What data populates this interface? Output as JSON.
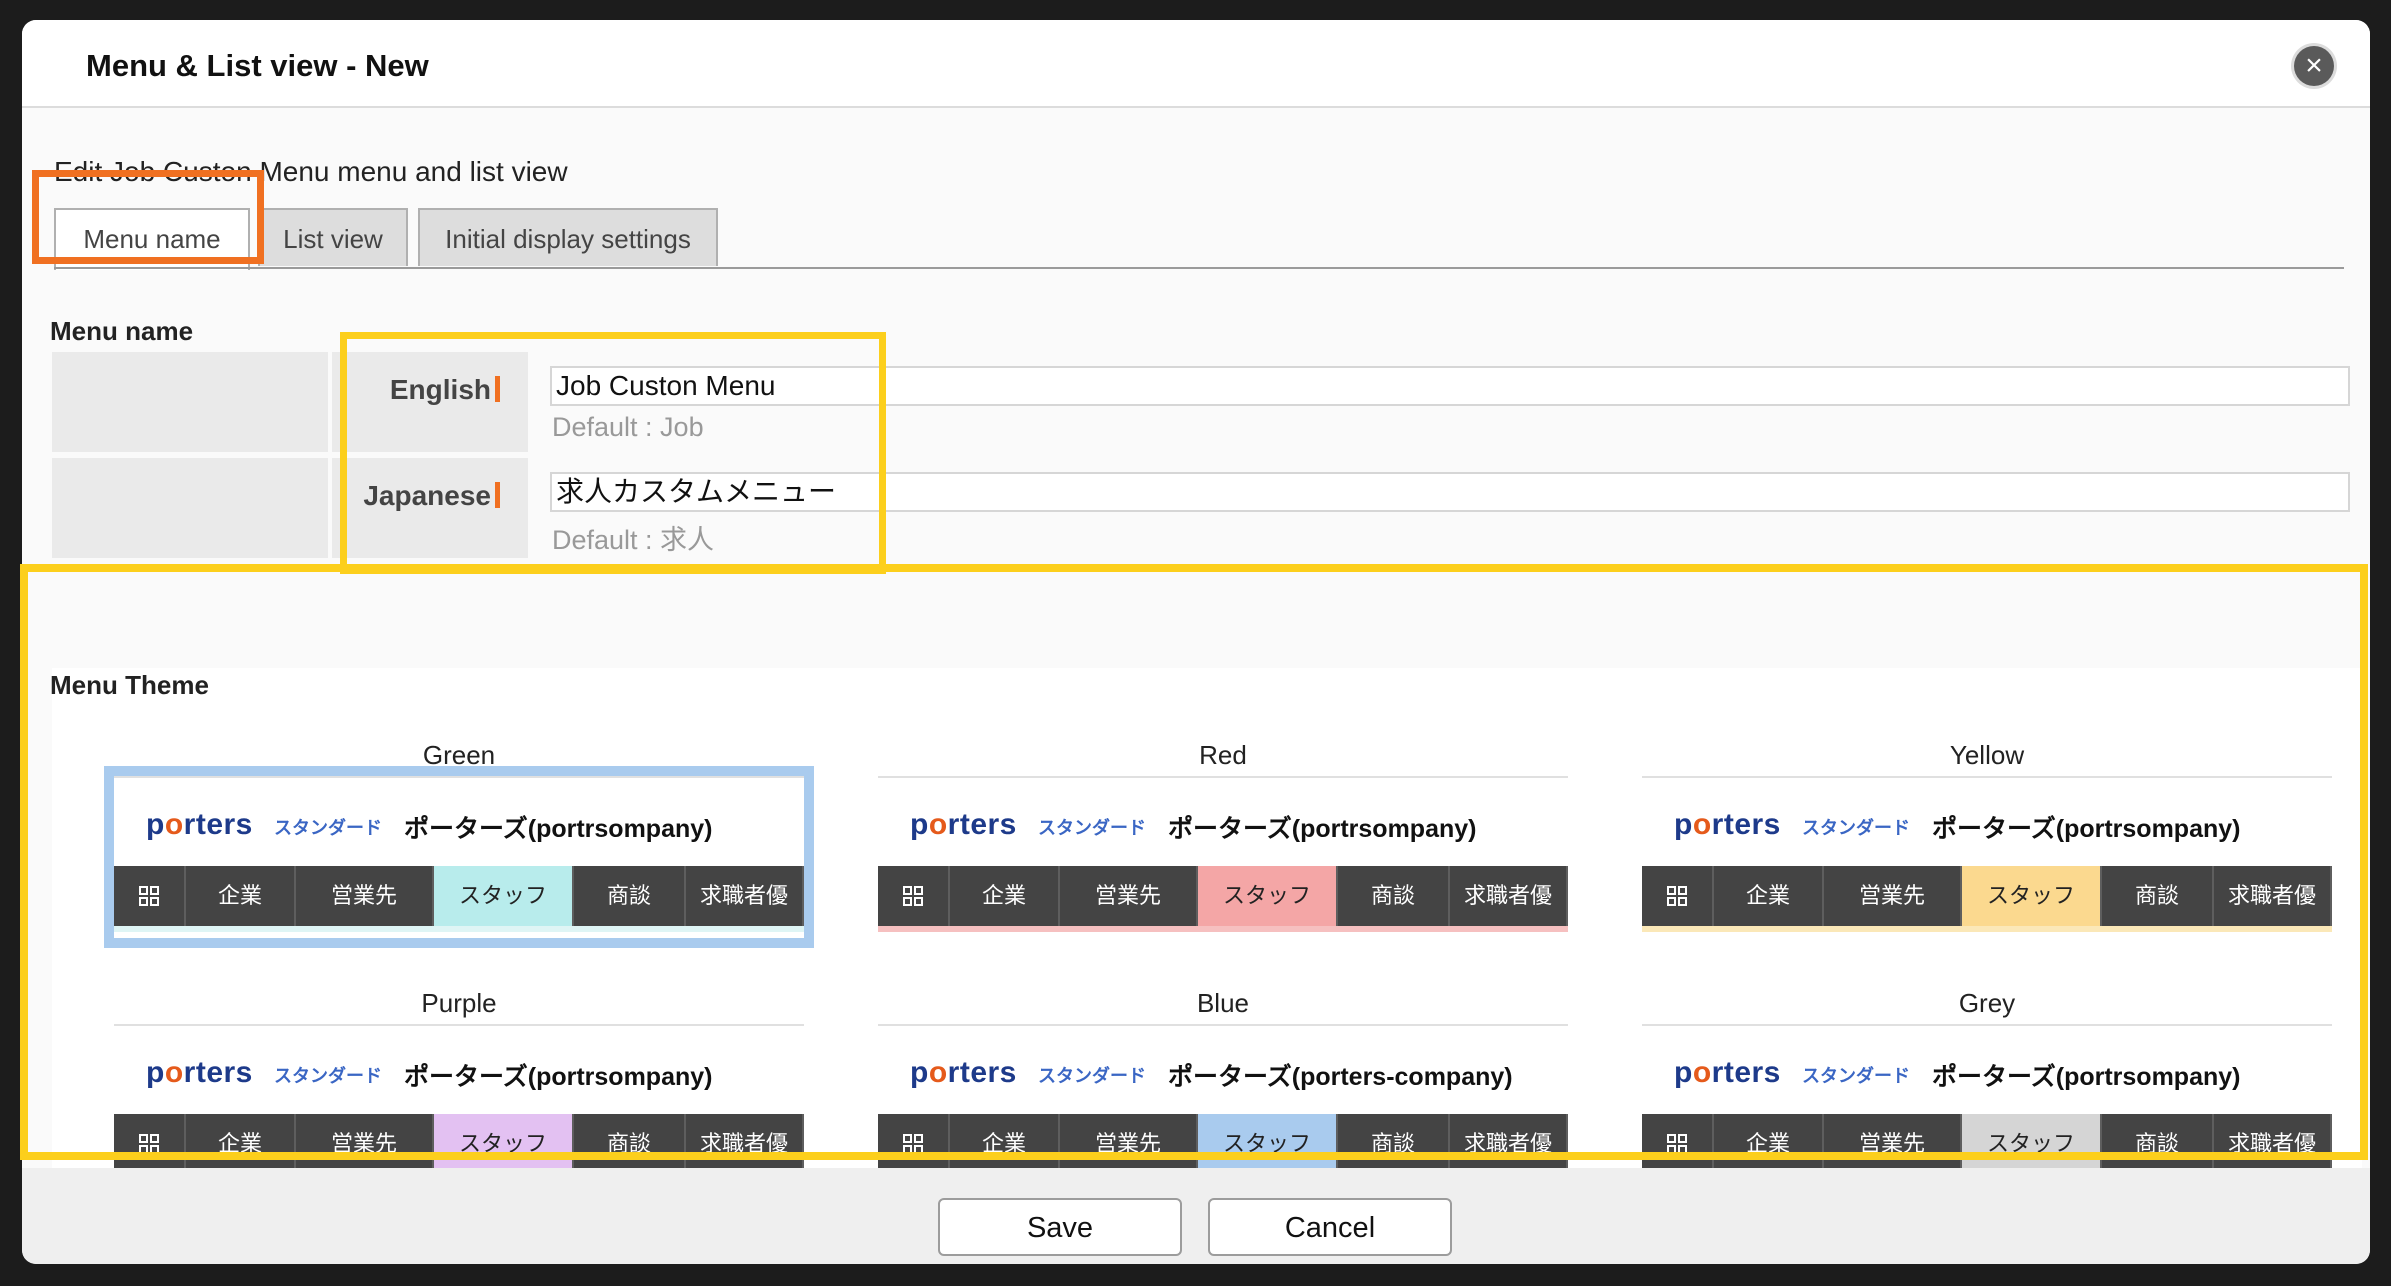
{
  "dialog": {
    "title": "Menu & List view - New",
    "close_icon": "close-icon"
  },
  "subtitle": "Edit Job Custon Menu menu and list view",
  "tabs": [
    {
      "label": "Menu name",
      "active": true
    },
    {
      "label": "List view",
      "active": false
    },
    {
      "label": "Initial display settings",
      "active": false
    }
  ],
  "menu_name": {
    "section_label": "Menu name",
    "english": {
      "label": "English",
      "value": "Job Custon Menu",
      "default": "Default : Job"
    },
    "japanese": {
      "label": "Japanese",
      "value": "求人カスタムメニュー",
      "default": "Default : 求人"
    }
  },
  "menu_theme": {
    "section_label": "Menu Theme",
    "themes": [
      {
        "name": "Green",
        "selected": true,
        "accent": "#b8ecec",
        "strip": "#dff5f5",
        "company": "ポーターズ(portrsompany)"
      },
      {
        "name": "Red",
        "selected": false,
        "accent": "#f4a6a6",
        "strip": "#f6c0c0",
        "company": "ポーターズ(portrsompany)"
      },
      {
        "name": "Yellow",
        "selected": false,
        "accent": "#fbd98f",
        "strip": "#fbe8b8",
        "company": "ポーターズ(portrsompany)"
      },
      {
        "name": "Purple",
        "selected": false,
        "accent": "#e3c1f2",
        "strip": "#ead3f5",
        "company": "ポーターズ(portrsompany)"
      },
      {
        "name": "Blue",
        "selected": false,
        "accent": "#a9cbee",
        "strip": "#c5dcf3",
        "company": "ポーターズ(porters-company)"
      },
      {
        "name": "Grey",
        "selected": false,
        "accent": "#d5d5d5",
        "strip": "#e6e6e6",
        "company": "ポーターズ(portrsompany)"
      }
    ],
    "preview": {
      "logo_text": "porters",
      "tagline": "スタンダード",
      "nav_items": [
        "企業",
        "営業先",
        "スタッフ",
        "商談",
        "求職者優"
      ]
    }
  },
  "footer": {
    "save_label": "Save",
    "cancel_label": "Cancel"
  },
  "colors": {
    "highlight_orange": "#f07021",
    "highlight_yellow": "#fccf1c",
    "selected_theme": "#a9cbee"
  }
}
